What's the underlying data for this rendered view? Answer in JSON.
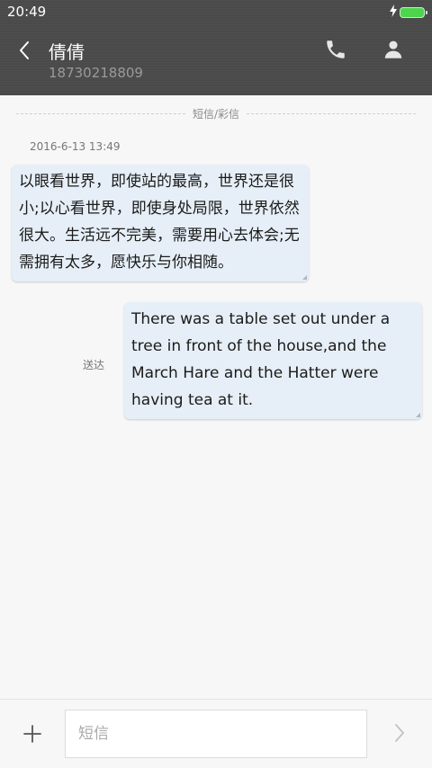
{
  "status_bar": {
    "time": "20:49"
  },
  "header": {
    "contact_name": "倩倩",
    "contact_number": "18730218809"
  },
  "thread": {
    "divider_label": "短信/彩信",
    "timestamp": "2016-6-13 13:49",
    "messages": [
      {
        "direction": "incoming",
        "text": "以眼看世界，即使站的最高，世界还是很小;以心看世界，即使身处局限，世界依然很大。生活远不完美，需要用心去体会;无需拥有太多，愿快乐与你相随。"
      },
      {
        "direction": "outgoing",
        "status": "送达",
        "text": "There was a table set out under a tree in front of the house,and the March Hare and the Hatter were having tea at it."
      }
    ]
  },
  "composer": {
    "placeholder": "短信"
  },
  "icons": {
    "back": "chevron-left-icon",
    "call": "phone-icon",
    "profile": "person-icon",
    "add": "plus-icon",
    "send": "chevron-right-icon",
    "battery": "battery-icon",
    "charging": "lightning-icon"
  },
  "colors": {
    "header_bg": "#4a4a4a",
    "bubble_bg": "#e6eff7",
    "battery": "#4cd64c",
    "page_bg": "#f7f7f7"
  }
}
